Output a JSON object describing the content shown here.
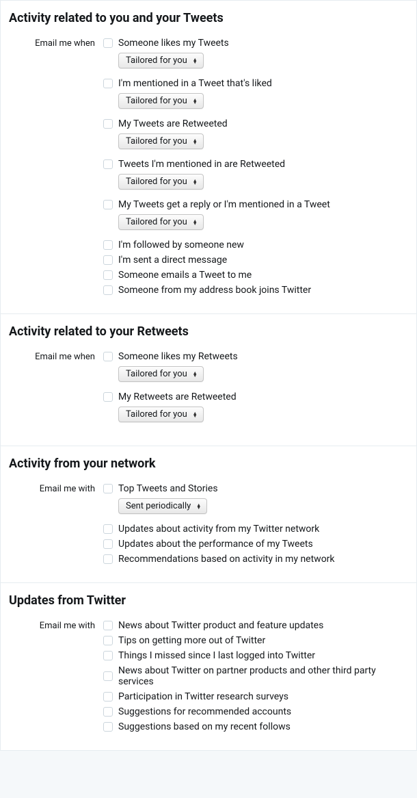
{
  "sections": [
    {
      "title": "Activity related to you and your Tweets",
      "rowLabel": "Email me when",
      "options": [
        {
          "label": "Someone likes my Tweets",
          "dropdown": "Tailored for you"
        },
        {
          "label": "I'm mentioned in a Tweet that's liked",
          "dropdown": "Tailored for you"
        },
        {
          "label": "My Tweets are Retweeted",
          "dropdown": "Tailored for you"
        },
        {
          "label": "Tweets I'm mentioned in are Retweeted",
          "dropdown": "Tailored for you"
        },
        {
          "label": "My Tweets get a reply or I'm mentioned in a Tweet",
          "dropdown": "Tailored for you"
        },
        {
          "label": "I'm followed by someone new"
        },
        {
          "label": "I'm sent a direct message"
        },
        {
          "label": "Someone emails a Tweet to me"
        },
        {
          "label": "Someone from my address book joins Twitter"
        }
      ]
    },
    {
      "title": "Activity related to your Retweets",
      "rowLabel": "Email me when",
      "options": [
        {
          "label": "Someone likes my Retweets",
          "dropdown": "Tailored for you"
        },
        {
          "label": "My Retweets are Retweeted",
          "dropdown": "Tailored for you"
        }
      ]
    },
    {
      "title": "Activity from your network",
      "rowLabel": "Email me with",
      "options": [
        {
          "label": "Top Tweets and Stories",
          "dropdown": "Sent periodically"
        },
        {
          "label": "Updates about activity from my Twitter network"
        },
        {
          "label": "Updates about the performance of my Tweets"
        },
        {
          "label": "Recommendations based on activity in my network"
        }
      ]
    },
    {
      "title": "Updates from Twitter",
      "rowLabel": "Email me with",
      "options": [
        {
          "label": "News about Twitter product and feature updates"
        },
        {
          "label": "Tips on getting more out of Twitter"
        },
        {
          "label": "Things I missed since I last logged into Twitter"
        },
        {
          "label": "News about Twitter on partner products and other third party services"
        },
        {
          "label": "Participation in Twitter research surveys"
        },
        {
          "label": "Suggestions for recommended accounts"
        },
        {
          "label": "Suggestions based on my recent follows"
        }
      ]
    }
  ]
}
